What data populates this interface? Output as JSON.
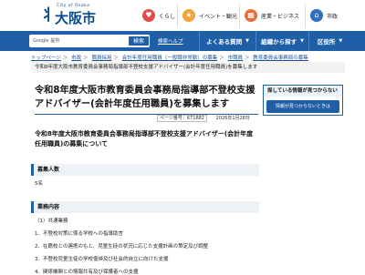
{
  "header": {
    "logo_en": "City of Osaka",
    "logo_jp": "大阪市",
    "nav": [
      {
        "label": "くらし",
        "icon": "heart-icon",
        "color": "#e24b4b"
      },
      {
        "label": "イベント・観光",
        "icon": "star-icon",
        "color": "#f2a33a"
      },
      {
        "label": "産業・ビジネス",
        "icon": "building-icon",
        "color": "#e2703a"
      },
      {
        "label": "市政",
        "icon": "city-hall-icon",
        "color": "#2f6fbd"
      }
    ]
  },
  "bluebar": {
    "search_brand": "Google 提供",
    "search_button": "検索",
    "help": "検索ヘルプ",
    "menu": [
      {
        "label": "よくある質問"
      },
      {
        "label": "組織から探す"
      },
      {
        "label": "区役所"
      }
    ]
  },
  "breadcrumb": {
    "items": [
      "トップページ",
      "市政",
      "職員採用",
      "会計年度任用職員（一般職非常勤）の募集",
      "市職員",
      "教育委員会事務局の募集"
    ],
    "current": "令和8年度大阪市教育委員会事務局指導部不登校支援アドバイザー(会計年度任用職員)を募集します"
  },
  "article": {
    "title": "令和8年度大阪市教育委員会事務局指導部不登校支援アドバイザー(会計年度任用職員)を募集します",
    "page_id_label": "ページ番号：671882",
    "date": "2026年1月28日",
    "lead": "令和8年度大阪市教育委員会事務局指導部不登校支援アドバイザー(会計年度任用職員)の募集について",
    "sections": [
      {
        "heading": "募集人数",
        "lines": [
          "5名"
        ]
      },
      {
        "heading": "業務内容",
        "lines": [
          "（1）共通業務",
          "1．不登校対策に係る学校への指導助言",
          "2．在籍校との連携のもと、児童生徒の状況に応じた支援計画の策定及び調整",
          "3．不登校児童生徒の学校復帰及び社会的自立に向けた支援",
          "4．関係機関との情報共有及び保護者への支援"
        ]
      }
    ]
  },
  "sidebar": {
    "heading": "探している情報が見つからない",
    "button": "情報が見つからないときは"
  }
}
